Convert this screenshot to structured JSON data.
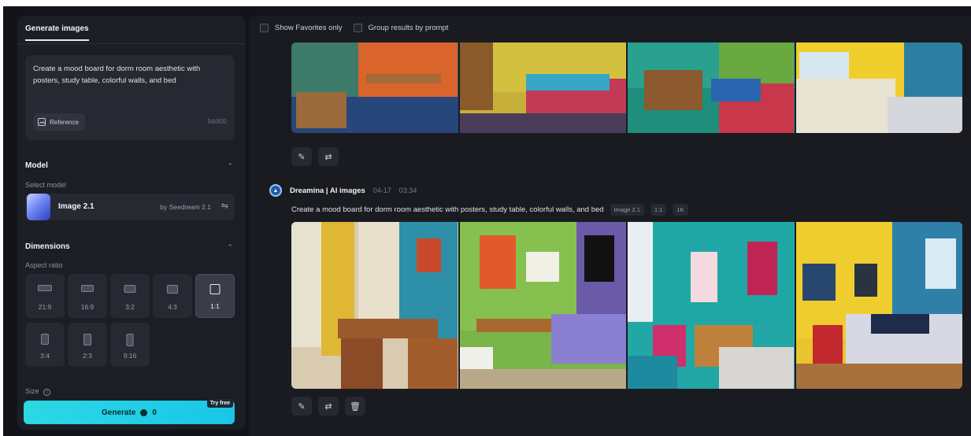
{
  "sidebar": {
    "tab_label": "Generate images",
    "prompt": "Create a mood board for dorm room aesthetic with posters, study table, colorful walls, and bed",
    "reference_label": "Reference",
    "char_count": "94/800",
    "model_section": "Model",
    "select_model_label": "Select model",
    "model_name": "Image 2.1",
    "model_by": "by Seedream 2.1",
    "dimensions_section": "Dimensions",
    "aspect_ratio_label": "Aspect ratio",
    "ratios": [
      "21:9",
      "16:9",
      "3:2",
      "4:3",
      "1:1",
      "3:4",
      "2:3",
      "9:16"
    ],
    "selected_ratio": "1:1",
    "size_label": "Size",
    "generate_label": "Generate",
    "generate_cost": "0",
    "try_free": "Try free"
  },
  "main": {
    "show_favorites": "Show Favorites only",
    "group_results": "Group results by prompt",
    "generation": {
      "name": "Dreamina | AI images",
      "date": "04-17",
      "time": "03:34",
      "prompt": "Create a mood board for dorm room aesthetic with posters, study table, colorful walls, and bed",
      "chips": [
        "Image 2.1",
        "1:1",
        "1K"
      ]
    }
  },
  "icons": {
    "edit": "edit-icon",
    "regenerate": "regenerate-icon",
    "delete": "delete-icon",
    "info": "info-icon"
  },
  "colors": {
    "accent": "#22cfe6",
    "background": "#131419",
    "panel": "#1c1e25"
  }
}
